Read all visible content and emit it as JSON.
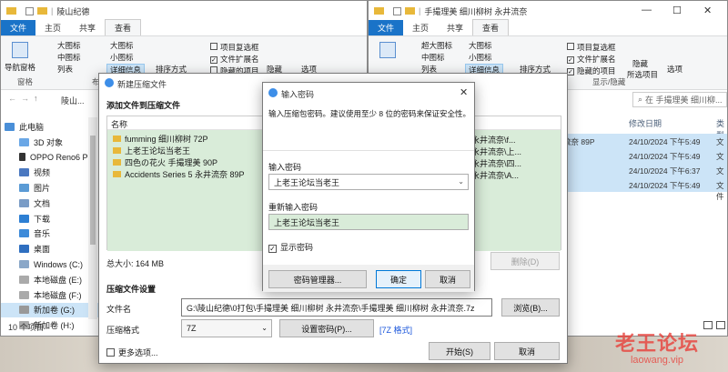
{
  "left_explorer": {
    "title": "陵山纪德",
    "tabs": [
      "文件",
      "主页",
      "共享",
      "查看"
    ],
    "ribbon": {
      "nav_pane": "导航窗格",
      "large_icons": "大图标",
      "medium_icons": "中图标",
      "list": "列表",
      "huge_icons": "大图标",
      "small_icons": "小图标",
      "details": "详细信息",
      "sort": "排序方式",
      "item_checkbox": "项目复选框",
      "file_ext": "文件扩展名",
      "hidden_items": "隐藏的项目",
      "hide": "隐藏",
      "options": "选项",
      "group_pane": "窗格",
      "group_layout": "布"
    },
    "address": "陵山...",
    "nav_items": [
      "此电脑",
      "3D 对象",
      "OPPO Reno6 Pro",
      "视频",
      "图片",
      "文档",
      "下载",
      "音乐",
      "桌面",
      "Windows (C:)",
      "本地磁盘 (E:)",
      "本地磁盘 (F:)",
      "新加卷 (G:)",
      "新加卷 (H:)"
    ],
    "status": "10 个项目"
  },
  "right_explorer": {
    "title": "手撮理美 细川柳树 永井流奈",
    "tabs": [
      "文件",
      "主页",
      "共享",
      "查看"
    ],
    "ribbon": {
      "huge_icons": "超大图标",
      "large_icons": "大图标",
      "medium_icons": "中图标",
      "small_icons": "小图标",
      "list": "列表",
      "details": "详细信息",
      "sort": "排序方式",
      "item_checkbox": "项目复选框",
      "file_ext": "文件扩展名",
      "hidden_items": "隐藏的项目",
      "hide": "隐藏",
      "hide_selected": "所选项目",
      "options": "选项",
      "group_show": "显示/隐藏"
    },
    "search_placeholder": "在 手撮理美 细川柳...",
    "columns": [
      "修改日期",
      "类型"
    ],
    "rows": [
      {
        "name": "流奈 89P",
        "date": "24/10/2024 下午5:49",
        "type": "文件"
      },
      {
        "name": "",
        "date": "24/10/2024 下午5:49",
        "type": "文件"
      },
      {
        "name": "",
        "date": "24/10/2024 下午6:37",
        "type": "文件"
      },
      {
        "name": "",
        "date": "24/10/2024 下午5:49",
        "type": "文件"
      }
    ]
  },
  "compress_dialog": {
    "title": "新建压缩文件",
    "add_section": "添加文件到压缩文件",
    "name_column": "名称",
    "files": [
      {
        "name": "fumming 细川柳树 72P",
        "path": "永井流奈\\f..."
      },
      {
        "name": "上老王论坛当老王",
        "path": "永井流奈\\上..."
      },
      {
        "name": "四色の花火 手撮理美 90P",
        "path": "永井流奈\\四..."
      },
      {
        "name": "Accidents Series 5 永井流奈 89P",
        "path": "永井流奈\\A..."
      }
    ],
    "total_size": "总大小: 164 MB",
    "delete_button": "删除(D)",
    "settings_section": "压缩文件设置",
    "filename_label": "文件名",
    "filename_value": "G:\\陵山纪德\\0打包\\手撮理美 细川柳树 永井流奈\\手撮理美 细川柳树 永井流奈.7z",
    "browse_button": "浏览(B)...",
    "format_label": "压缩格式",
    "format_value": "7Z",
    "set_password_button": "设置密码(P)...",
    "format_link": "[7Z 格式]",
    "more_options": "更多选项...",
    "start_button": "开始(S)",
    "cancel_button": "取消"
  },
  "password_dialog": {
    "title": "输入密码",
    "description": "输入压缩包密码。建议使用至少 8 位的密码来保证安全性。",
    "password_label": "输入密码",
    "password_value": "上老王论坛当老王",
    "confirm_label": "重新输入密码",
    "confirm_value": "上老王论坛当老王",
    "show_password": "显示密码",
    "manager_button": "密码管理器...",
    "ok_button": "确定",
    "cancel_button": "取消"
  },
  "watermark": {
    "line1": "老王论坛",
    "line2": "laowang.vip"
  },
  "colors": {
    "accent": "#1a73c8",
    "green_highlight": "#d9ecd9",
    "selection": "#cce4f7",
    "watermark": "#e8403a"
  }
}
